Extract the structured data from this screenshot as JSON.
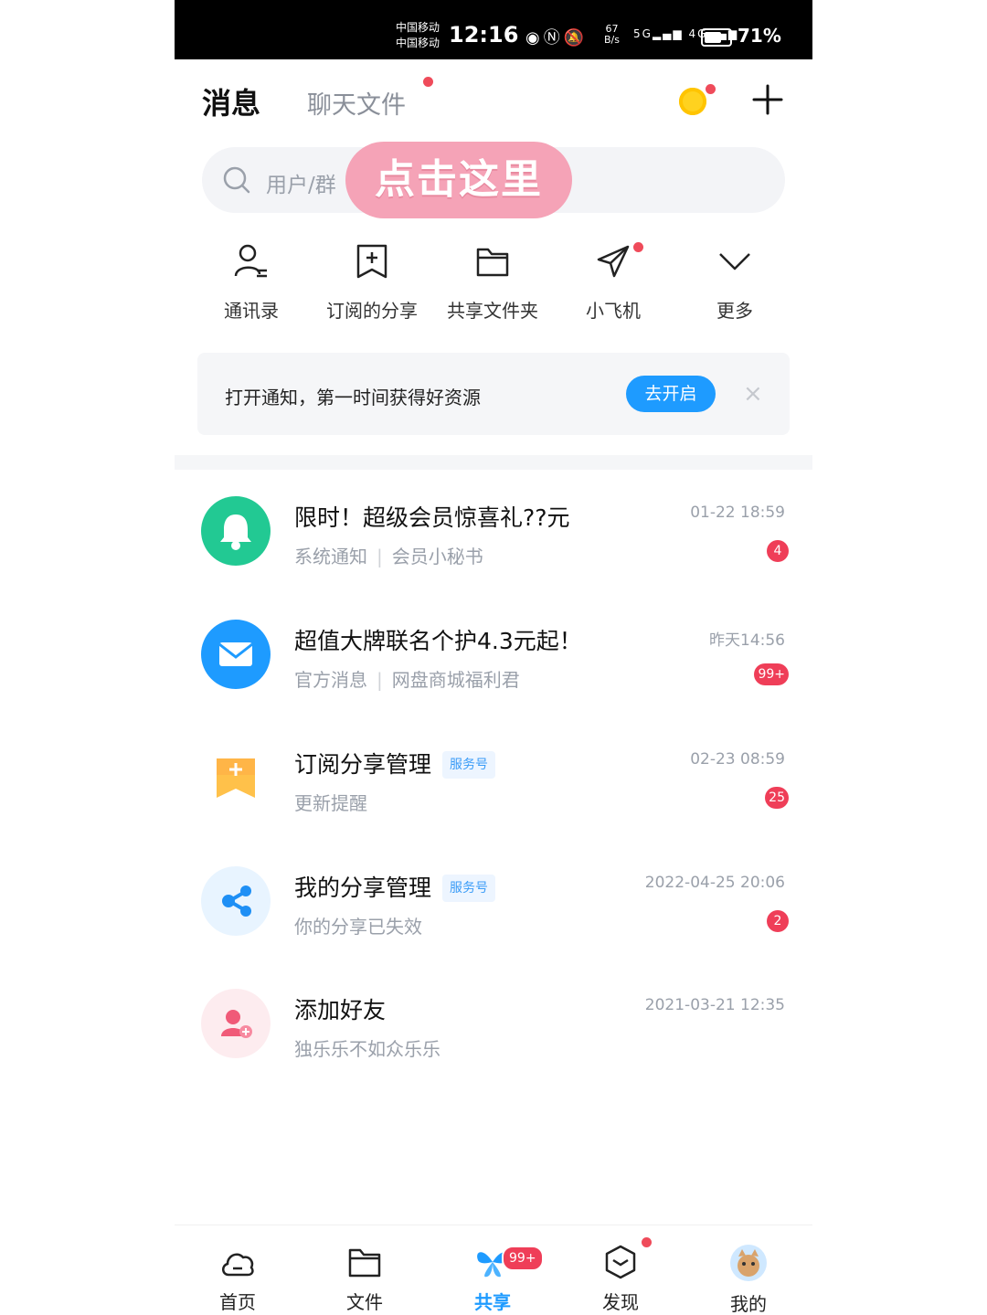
{
  "status_bar": {
    "carrier_1": "中国移动",
    "carrier_2": "中国移动",
    "time": "12:16",
    "net_speed_value": "67",
    "net_speed_unit": "B/s",
    "signal_1": "5G",
    "signal_2": "4G",
    "battery_pct": "71%",
    "battery_level": 0.71
  },
  "header": {
    "tab_messages": "消息",
    "tab_chat_files": "聊天文件"
  },
  "search": {
    "placeholder": "用户/群",
    "overlay_tip": "点击这里"
  },
  "quick_actions": [
    {
      "label": "通讯录",
      "icon": "contacts-icon"
    },
    {
      "label": "订阅的分享",
      "icon": "subscribe-share-icon"
    },
    {
      "label": "共享文件夹",
      "icon": "shared-folder-icon"
    },
    {
      "label": "小飞机",
      "icon": "paper-plane-icon"
    },
    {
      "label": "更多",
      "icon": "chevron-down-icon"
    }
  ],
  "notice": {
    "text": "打开通知，第一时间获得好资源",
    "button": "去开启",
    "close": "×"
  },
  "messages": [
    {
      "title": "限时！超级会员惊喜礼??元",
      "category": "系统通知",
      "sender": "会员小秘书",
      "time": "01-22 18:59",
      "badge": "4",
      "icon": "bell-icon",
      "color": "#22c993"
    },
    {
      "title": "超值大牌联名个护4.3元起！",
      "category": "官方消息",
      "sender": "网盘商城福利君",
      "time": "昨天14:56",
      "badge": "99+",
      "icon": "mail-icon",
      "color": "#1e9bff"
    },
    {
      "title": "订阅分享管理",
      "tag": "服务号",
      "subtitle": "更新提醒",
      "time": "02-23 08:59",
      "badge": "25",
      "icon": "bookmark-plus-icon",
      "color": "#ffb547"
    },
    {
      "title": "我的分享管理",
      "tag": "服务号",
      "subtitle": "你的分享已失效",
      "time": "2022-04-25 20:06",
      "badge": "2",
      "icon": "share-icon",
      "color": "#e8f4ff"
    },
    {
      "title": "添加好友",
      "subtitle": "独乐乐不如众乐乐",
      "time": "2021-03-21 12:35",
      "icon": "add-friend-icon",
      "color": "#fdecef"
    }
  ],
  "bottom_nav": [
    {
      "label": "首页",
      "icon": "home-cloud-icon"
    },
    {
      "label": "文件",
      "icon": "folder-icon"
    },
    {
      "label": "共享",
      "icon": "share-butterfly-icon",
      "badge": "99+",
      "active": true
    },
    {
      "label": "发现",
      "icon": "discover-box-icon"
    },
    {
      "label": "我的",
      "icon": "profile-avatar-icon"
    }
  ],
  "colors": {
    "accent": "#1e9bff",
    "badge": "#ef3e58",
    "tip_overlay": "#f5a3b7"
  }
}
